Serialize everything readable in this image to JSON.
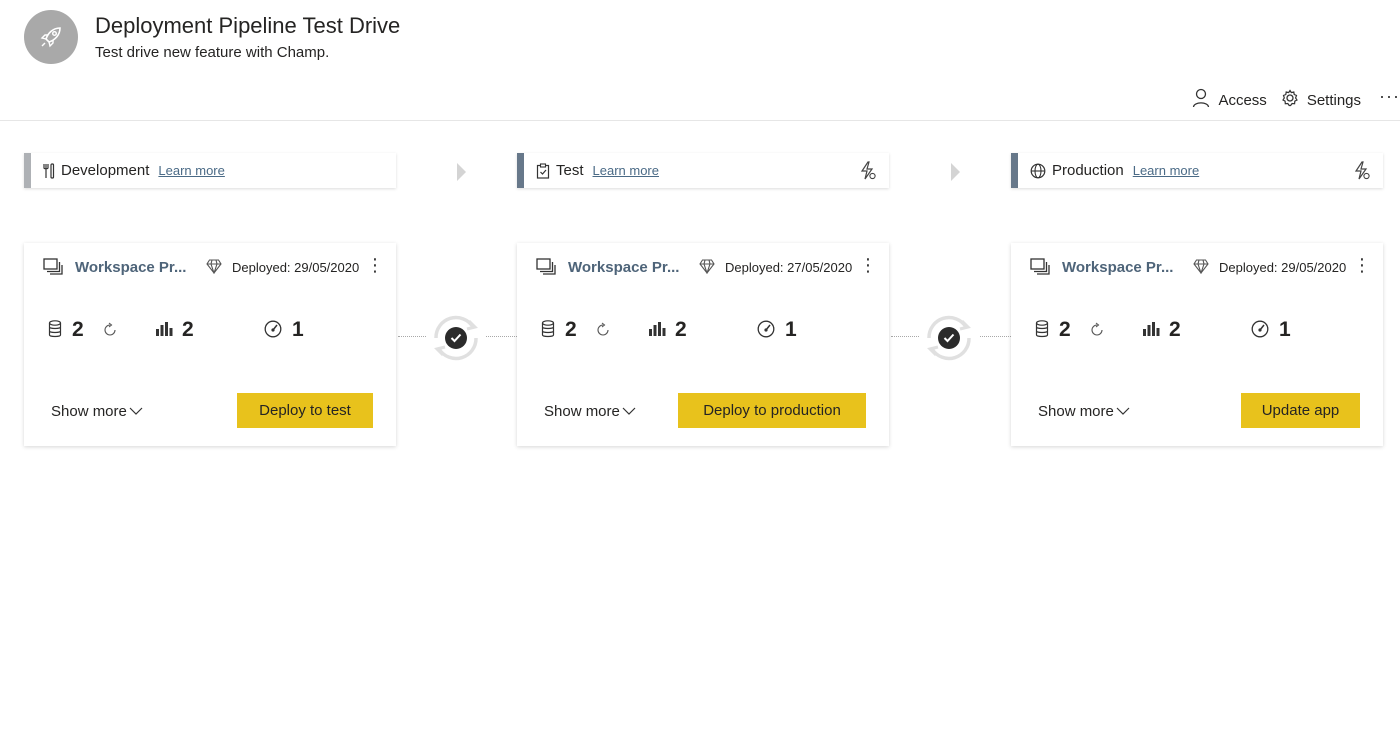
{
  "header": {
    "title": "Deployment Pipeline Test Drive",
    "subtitle": "Test drive new feature with Champ.",
    "actions": {
      "access": "Access",
      "settings": "Settings",
      "more": "···"
    }
  },
  "stages": [
    {
      "name": "Development",
      "learn_more": "Learn more",
      "workspace": "Workspace Pr...",
      "deployed": "Deployed: 29/05/2020",
      "datasets": "2",
      "reports": "2",
      "dashboards": "1",
      "show_more": "Show more",
      "button": "Deploy to test"
    },
    {
      "name": "Test",
      "learn_more": "Learn more",
      "workspace": "Workspace Pr...",
      "deployed": "Deployed: 27/05/2020",
      "datasets": "2",
      "reports": "2",
      "dashboards": "1",
      "show_more": "Show more",
      "button": "Deploy to production"
    },
    {
      "name": "Production",
      "learn_more": "Learn more",
      "workspace": "Workspace Pr...",
      "deployed": "Deployed: 29/05/2020",
      "datasets": "2",
      "reports": "2",
      "dashboards": "1",
      "show_more": "Show more",
      "button": "Update app"
    }
  ],
  "colors": {
    "accent": "#e8c21c",
    "stage_bar_dev": "#aeb1b5",
    "stage_bar": "#67788a",
    "link": "#4a6a86"
  }
}
